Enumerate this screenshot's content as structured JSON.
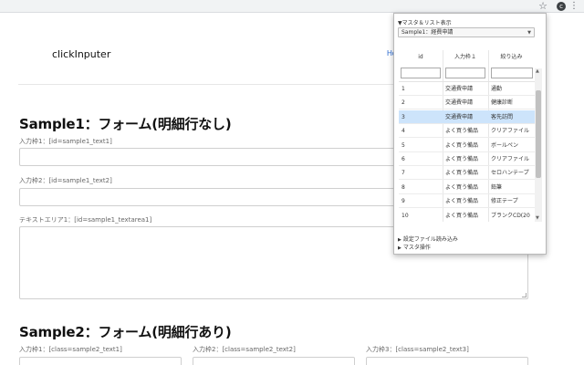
{
  "browser": {
    "star_icon": "☆",
    "extension_letter": "c",
    "menu_icon": "⋮"
  },
  "site": {
    "logo": "clickInputer",
    "nav_link": "Ho"
  },
  "sample1": {
    "title": "Sample1：フォーム(明細行なし)",
    "label1": "入力枠1：[id=sample1_text1]",
    "label2": "入力枠2：[id=sample1_text2]",
    "label3": "テキストエリア1：[id=sample1_textarea1]"
  },
  "sample2": {
    "title": "Sample2：フォーム(明細行あり)",
    "label1": "入力枠1：[class=sample2_text1]",
    "label2": "入力枠2：[class=sample2_text2]",
    "label3": "入力枠3：[class=sample2_text3]"
  },
  "popup": {
    "heading": "▼マスタ＆リスト表示",
    "select_value": "Sample1：経費申請",
    "select_arrow": "▼",
    "columns": [
      "id",
      "入力枠１",
      "絞り込み"
    ],
    "rows": [
      [
        "1",
        "交通費申請",
        "通勤"
      ],
      [
        "2",
        "交通費申請",
        "健康診断"
      ],
      [
        "3",
        "交通費申請",
        "客先訪問"
      ],
      [
        "4",
        "よく買う備品",
        "クリアファイル"
      ],
      [
        "5",
        "よく買う備品",
        "ボールペン"
      ],
      [
        "6",
        "よく買う備品",
        "クリアファイル"
      ],
      [
        "7",
        "よく買う備品",
        "セロハンテープ"
      ],
      [
        "8",
        "よく買う備品",
        "鉛筆"
      ],
      [
        "9",
        "よく買う備品",
        "修正テープ"
      ],
      [
        "10",
        "よく買う備品",
        "ブランクCD(20"
      ]
    ],
    "selected_row": 2,
    "scroll_up": "▲",
    "scroll_down": "▼",
    "toggle1": "設定ファイル読み込み",
    "toggle2": "マスタ操作",
    "toggle_icon": "▶"
  }
}
